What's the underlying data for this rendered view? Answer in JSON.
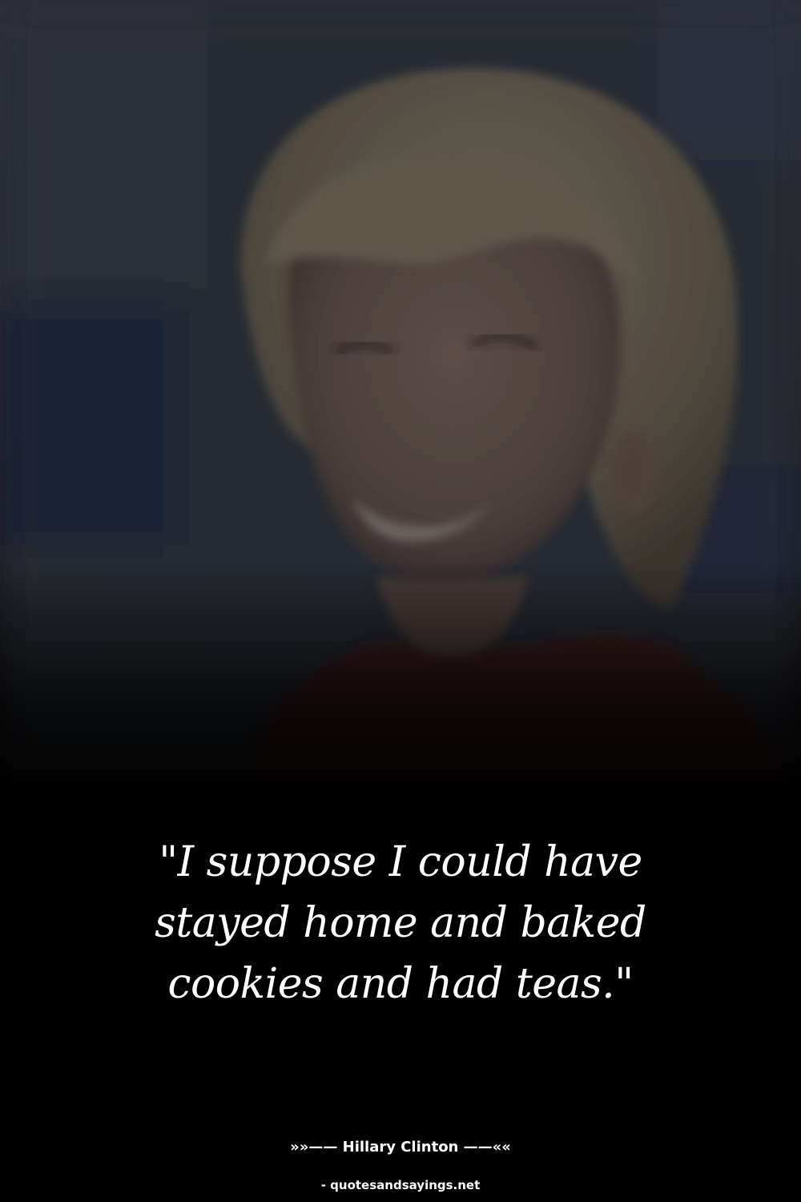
{
  "quote": {
    "text": "\"I suppose I could have stayed home and baked cookies and had teas.\""
  },
  "attribution": {
    "prefix": "»»—— ",
    "author": "Hillary Clinton",
    "suffix": " ——««"
  },
  "source": {
    "text": "- quotesandsayings.net"
  },
  "colors": {
    "background": "#000000",
    "text": "#ffffff",
    "photo_tint": "#24272f"
  }
}
